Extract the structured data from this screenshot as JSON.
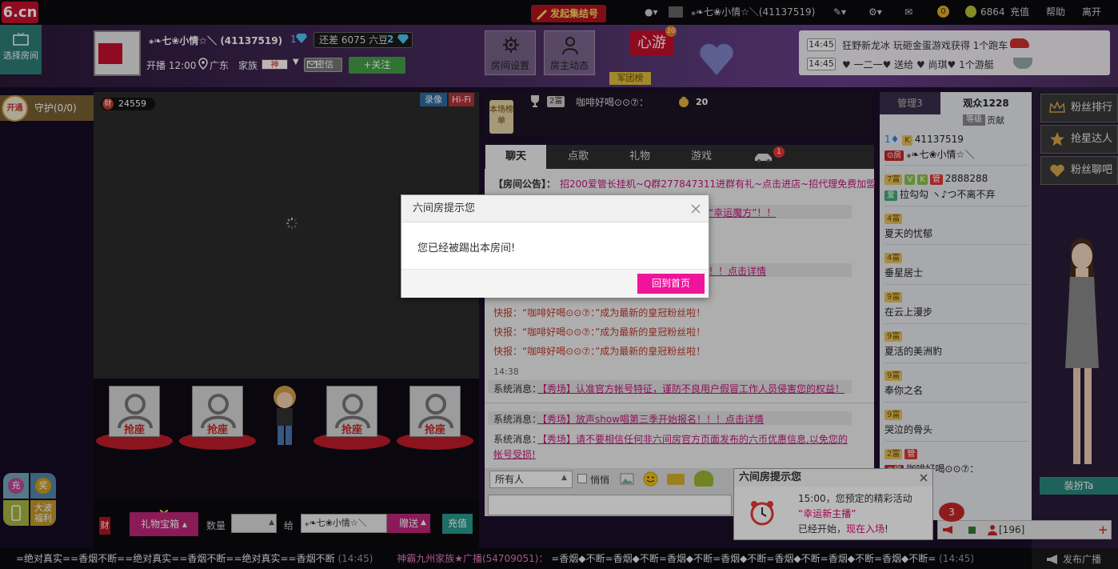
{
  "topbar": {
    "logo": "6.cn",
    "gather": "发起集结号",
    "user": "⁎❧七❀小情☆＼(41137519)",
    "coins": "0",
    "beans": "6864",
    "recharge": "充值",
    "help": "帮助",
    "exit": "离开"
  },
  "header": {
    "select_room": "选择房间",
    "nick": "⁎❧七❀小情☆＼ (41137519)",
    "level1": "1",
    "gap_text": "还差 6075 六豆",
    "level2": "2",
    "live": "开播 12:00",
    "location": "广东",
    "family_label": "家族",
    "family_badge": "神",
    "msg": "密信",
    "follow": "+关注",
    "room_settings": "房间设置",
    "host_dynamic": "房主动态",
    "xinyou": "心游",
    "xinyou_badge": "20",
    "legion": "军团榜",
    "news": [
      {
        "time": "14:45",
        "text": "狂野新龙冰 玩砸金蛋游戏获得 1个跑车"
      },
      {
        "time": "14:45",
        "text": "♥ 一二一♥ 送给 ♥ 尚琪♥ 1个游艇"
      }
    ]
  },
  "left": {
    "open": "开通",
    "guard": "守护(0/0)"
  },
  "video": {
    "rich": "24559",
    "rec": "录像",
    "hifi": "Hi-Fi"
  },
  "seats": [
    "抢座",
    "抢座",
    "抢座",
    "抢座"
  ],
  "giftbar": {
    "rich": "财",
    "giftbox": "礼物宝箱",
    "qty_label": "数量",
    "give_label": "给",
    "target": "⁎❧七❀小情☆＼",
    "send": "赠送",
    "recharge": "充值"
  },
  "sidepromo": {
    "charge": "充",
    "prize": "奖",
    "wave": "大波",
    "welfare": "福利"
  },
  "rank": {
    "badge": "本场榜单",
    "level": "2富",
    "user": "咖啡好喝⊙⊙⑦：",
    "count": "20"
  },
  "tabs": [
    "聊天",
    "点歌",
    "礼物",
    "游戏",
    ""
  ],
  "tab_badge": "1",
  "chat": {
    "announce_label": "【房间公告】：",
    "announce": "招200爱管长挂机~Q群277847311进群有礼~点击进店~招代理免费加盟",
    "line2": "“幸运魔方”！！",
    "line3": "！！点击详情",
    "flash": [
      "快报：“咖啡好喝⊙⊙⑦：”成为最新的皇冠粉丝啦！",
      "快报：“咖啡好喝⊙⊙⑦：”成为最新的皇冠粉丝啦！",
      "快报：“咖啡好喝⊙⊙⑦：”成为最新的皇冠粉丝啦！"
    ],
    "time": "14:38",
    "sys_label": "系统消息：",
    "sys1": "【秀场】认准官方帐号特征，谨防不良用户假冒工作人员侵害您的权益！",
    "sys2": "【秀场】放声show唱第三季开始报名！！！点击详情",
    "sys3a": "【秀场】请不要相信任何非六间房官方页面发布的六币优惠信息,以免您的",
    "sys3b": "帐号受损!"
  },
  "chatbottom": {
    "who": "所有人",
    "whisper": "悄悄"
  },
  "audience": {
    "admin_tab": "管理3",
    "aud_tab": "观众1228",
    "rank_badge": "等级",
    "contrib": "贡献",
    "list": [
      {
        "lv": "1",
        "id": "41137519",
        "name": "⁎❧七❀小情☆＼"
      },
      {
        "lv": "7富",
        "id": "2888288",
        "name": "拉勾勾 ヽ♪つ不离不弃"
      },
      {
        "lv": "4富",
        "name": "夏天的忧郁"
      },
      {
        "lv": "4富",
        "name": "垂星居士"
      },
      {
        "lv": "9富",
        "name": "在云上漫步"
      },
      {
        "lv": "9富",
        "name": "夏活的美洲豹"
      },
      {
        "lv": "9富",
        "name": "奉你之名"
      },
      {
        "lv": "9富",
        "name": "哭泣的骨头"
      },
      {
        "lv": "2富",
        "name": "咖啡好喝⊙⊙⑦："
      }
    ]
  },
  "rightside": {
    "fans_rank": "粉丝排行",
    "star": "抢星达人",
    "fans_bar": "粉丝聊吧",
    "dress": "装扮Ta"
  },
  "statusbar": {
    "count": "[196]",
    "badge": "3"
  },
  "bottombar": {
    "ticker1": "=绝对真实==香烟不断==绝对真实==香烟不断==绝对真实==香烟不断",
    "time1": "(14:45)",
    "ticker2_name": "神霸九州家族★广播(54709051)：",
    "ticker2": "=香烟◆不断=香烟◆不断=香烟◆不断=香烟◆不断=香烟◆不断=香烟◆不断=香烟◆不断=",
    "time2": "(14:45)",
    "broadcast": "发布广播"
  },
  "modal": {
    "title": "六间房提示您",
    "message": "您已经被踢出本房间!",
    "home": "回到首页"
  },
  "notice": {
    "title": "六间房提示您",
    "line1": "15:00，您预定的精彩活动",
    "line2": "“幸运新主播”",
    "line3a": "已经开始，",
    "line3b": "现在入场",
    "line3c": "!"
  }
}
